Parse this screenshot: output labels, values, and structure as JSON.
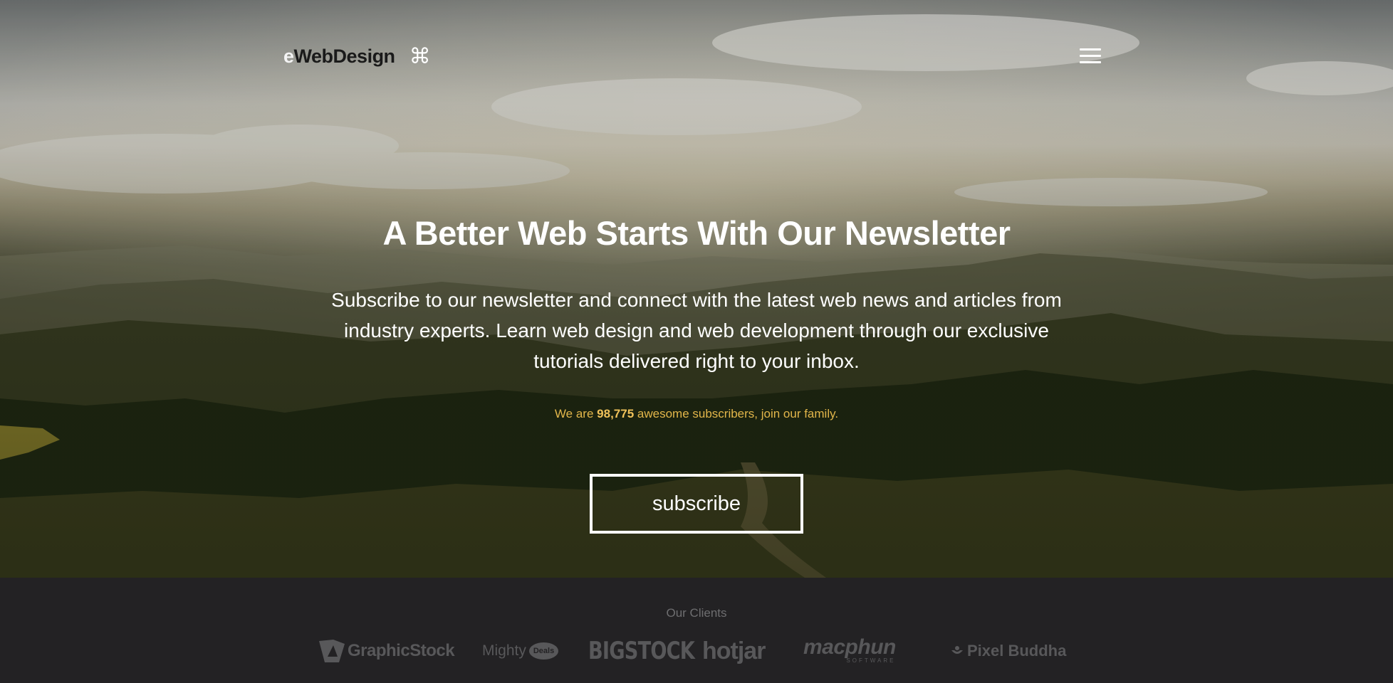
{
  "brand": {
    "logo_e": "e",
    "logo_text": "WebDesign",
    "logo_symbol": "⌘"
  },
  "nav": {
    "menu_icon": "hamburger-menu-icon"
  },
  "hero": {
    "headline": "A Better Web Starts With Our Newsletter",
    "description_lines": [
      "Subscribe to our newsletter and connect with the latest web news and articles from",
      "industry experts. Learn web design and web development through our exclusive",
      "tutorials delivered right to your inbox."
    ],
    "subscriber_prefix": "We are",
    "subscriber_count": "98,775",
    "subscriber_suffix": "awesome subscribers, join our family.",
    "subscribe_label": "subscribe"
  },
  "clients": {
    "title": "Our Clients",
    "logos": [
      {
        "name": "GraphicStock",
        "icon": "graphicstock-logo"
      },
      {
        "name": "Mighty",
        "badge": "Deals",
        "icon": "mightydeals-logo"
      },
      {
        "name": "BIGSTOCK",
        "icon": "bigstock-logo"
      },
      {
        "name": "hotjar",
        "icon": "hotjar-logo"
      },
      {
        "name": "macphun",
        "sub": "SOFTWARE",
        "icon": "macphun-logo"
      },
      {
        "name": "Pixel Buddha",
        "icon": "pixelbuddha-logo"
      }
    ]
  },
  "colors": {
    "accent": "#e2b64a",
    "footer_bg": "#232224",
    "logo_gray": "#58585a"
  }
}
